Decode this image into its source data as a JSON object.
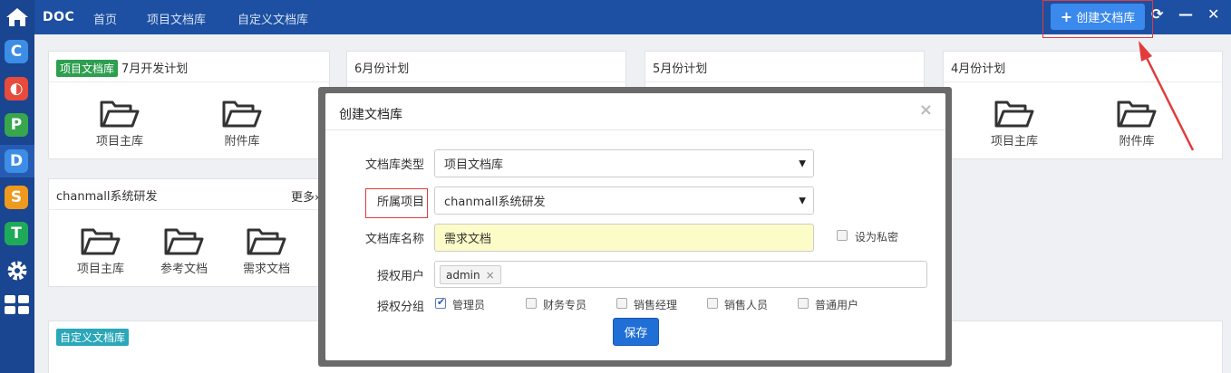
{
  "topbar": {
    "brand": "DOC",
    "nav": [
      "首页",
      "项目文档库",
      "自定义文档库"
    ],
    "create_label": "创建文档库"
  },
  "sidebar": {
    "apps": [
      {
        "icon": "c-app-icon",
        "letter": "C",
        "color": "#3c8de6"
      },
      {
        "icon": "o-app-icon",
        "letter": "◐",
        "color": "#e84a3c"
      },
      {
        "icon": "p-app-icon",
        "letter": "P",
        "color": "#37a64d"
      },
      {
        "icon": "d-app-icon",
        "letter": "D",
        "color": "#3c8de6"
      },
      {
        "icon": "s-app-icon",
        "letter": "S",
        "color": "#f09a1d"
      },
      {
        "icon": "t-app-icon",
        "letter": "T",
        "color": "#1faa59"
      }
    ]
  },
  "panels": {
    "p1": {
      "tag": "项目文档库",
      "title": "7月开发计划",
      "items": [
        "项目主库",
        "附件库"
      ]
    },
    "p2": {
      "title": "6月份计划"
    },
    "p3": {
      "title": "5月份计划"
    },
    "p4": {
      "title": "4月份计划",
      "items": [
        "项目主库",
        "附件库"
      ]
    },
    "p5": {
      "title": "chanmall系统研发",
      "more": "更多»",
      "items": [
        "项目主库",
        "参考文档",
        "需求文档"
      ]
    },
    "p6": {
      "tag": "自定义文档库"
    }
  },
  "modal": {
    "title": "创建文档库",
    "close": "×",
    "labels": {
      "type": "文档库类型",
      "project": "所属项目",
      "name": "文档库名称",
      "users": "授权用户",
      "groups": "授权分组"
    },
    "type_value": "项目文档库",
    "project_value": "chanmall系统研发",
    "name_value": "需求文档",
    "private_label": "设为私密",
    "user_chip": "admin",
    "chip_remove": "×",
    "groups": [
      {
        "label": "管理员",
        "checked": true
      },
      {
        "label": "财务专员",
        "checked": false
      },
      {
        "label": "销售经理",
        "checked": false
      },
      {
        "label": "销售人员",
        "checked": false
      },
      {
        "label": "普通用户",
        "checked": false
      }
    ],
    "save_label": "保存"
  },
  "colors": {
    "topbar": "#1d50a2",
    "sidebar": "#1a4590",
    "primary_button": "#3a89ec",
    "tag_project": "#2e9e4f",
    "tag_custom": "#2aa7b8",
    "highlight": "#e23b3b"
  }
}
